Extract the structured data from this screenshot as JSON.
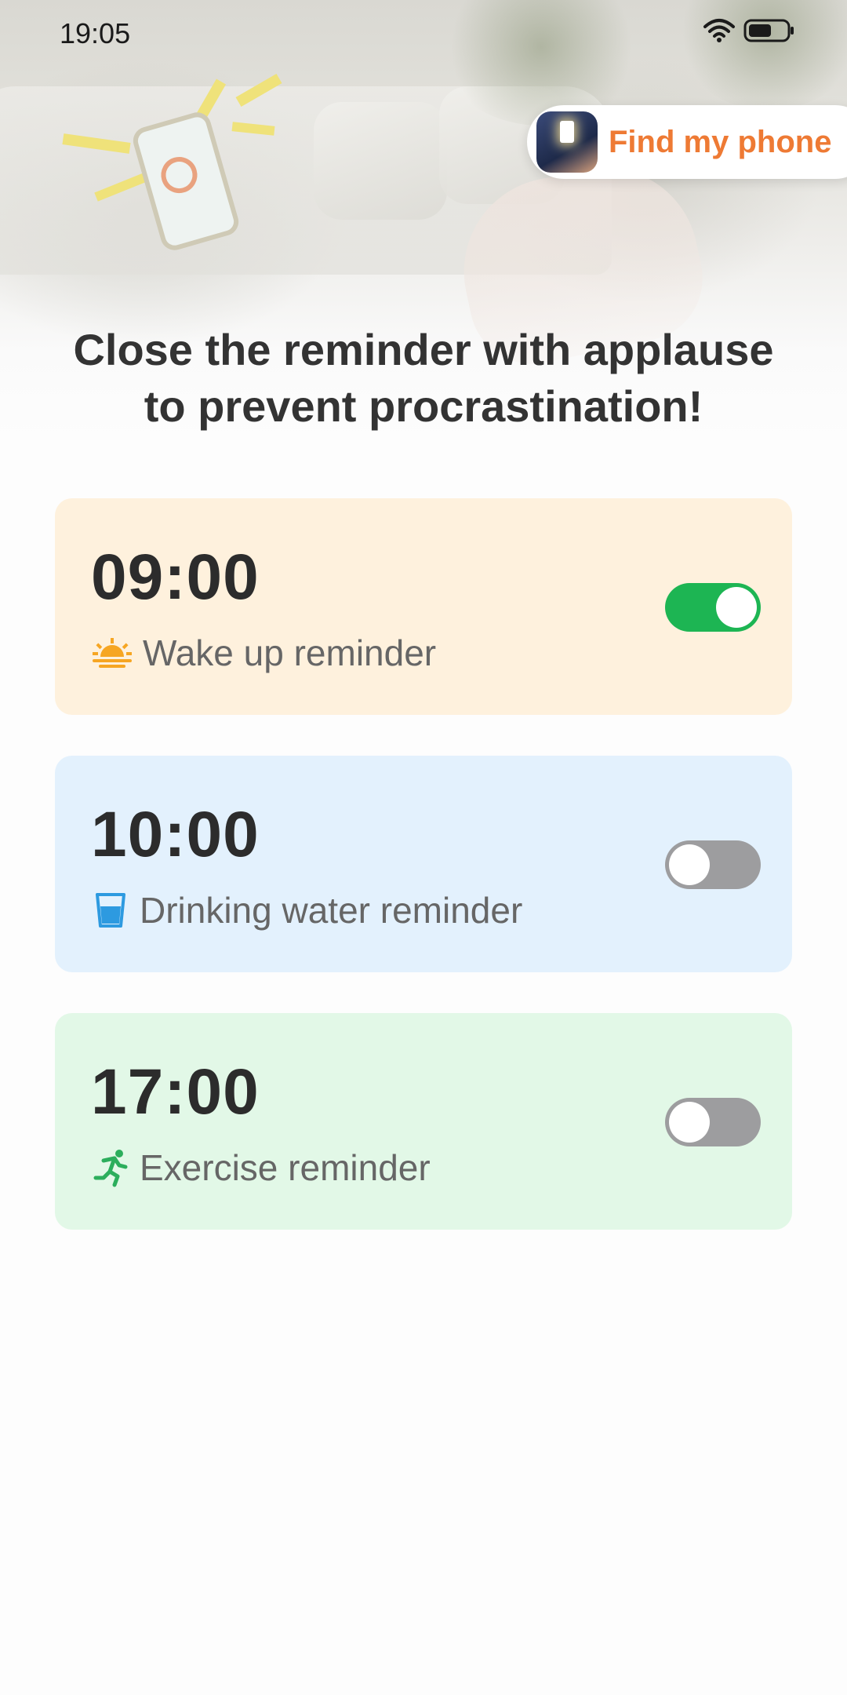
{
  "status_bar": {
    "time": "19:05"
  },
  "find_phone": {
    "label": "Find my phone"
  },
  "headline": {
    "line1": "Close the reminder with applause",
    "line2": "to prevent procrastination!"
  },
  "reminders": [
    {
      "time": "09:00",
      "label": "Wake up reminder",
      "icon": "sunrise-icon",
      "enabled": true
    },
    {
      "time": "10:00",
      "label": "Drinking water reminder",
      "icon": "water-cup-icon",
      "enabled": false
    },
    {
      "time": "17:00",
      "label": "Exercise reminder",
      "icon": "running-icon",
      "enabled": false
    }
  ],
  "colors": {
    "accent_orange": "#ee7a34",
    "toggle_on": "#1db553",
    "toggle_off": "#9d9d9f",
    "card_wake": "#fef1dd",
    "card_water": "#e3f1fd",
    "card_exercise": "#e2f8e7"
  }
}
